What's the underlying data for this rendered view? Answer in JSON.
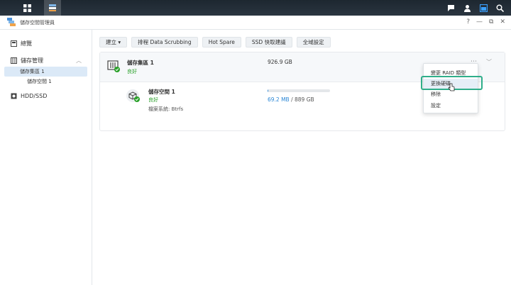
{
  "app": {
    "title": "儲存空間管理員"
  },
  "taskbar": {
    "left_icons": [
      "grid-icon",
      "storage-manager-icon"
    ],
    "right_icons": [
      "chat-icon",
      "user-icon",
      "widget-icon",
      "search-icon"
    ]
  },
  "window_controls": {
    "help": "?",
    "minimize": "—",
    "restore": "⧉",
    "close": "✕"
  },
  "sidebar": {
    "overview": "總覽",
    "storage": "儲存管理",
    "pool": "儲存集區 1",
    "volume": "儲存空間 1",
    "hdd": "HDD/SSD"
  },
  "toolbar": {
    "create": "建立 ▾",
    "scrubbing": "排程 Data Scrubbing",
    "hotspare": "Hot Spare",
    "ssdcache": "SSD 快取建議",
    "global": "全域設定"
  },
  "pool": {
    "name": "儲存集區 1",
    "status": "良好",
    "size": "926.9 GB"
  },
  "volume": {
    "name": "儲存空間 1",
    "status": "良好",
    "filesystem": "檔案系統: Btrfs",
    "used": "69.2 MB",
    "total": " / 889 GB",
    "usage_fraction": 0.0001
  },
  "context_menu": {
    "items": [
      "變更 RAID 類型",
      "更換硬碟",
      "移除",
      "設定"
    ],
    "hovered_index": 1
  },
  "colors": {
    "accent": "#2b87d6",
    "ok": "#2aa12a",
    "highlight": "#2fae8a"
  }
}
